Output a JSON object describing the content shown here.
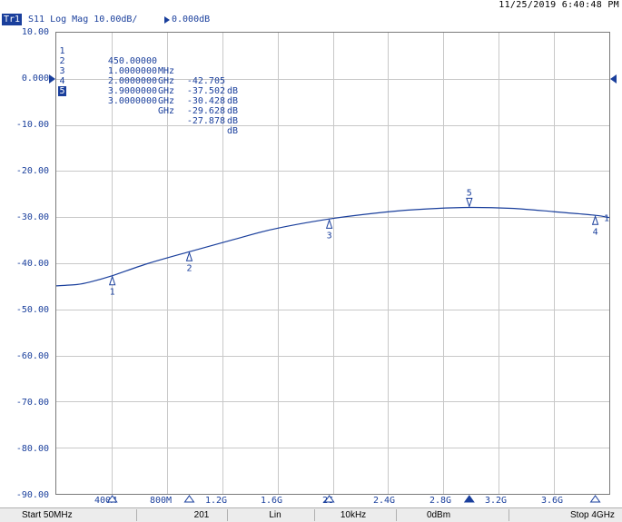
{
  "timestamp": "11/25/2019  6:40:48 PM",
  "trace": {
    "id": "Tr1",
    "parameter": "S11 Log Mag 10.00dB/",
    "reference": "0.000dB"
  },
  "y_axis": {
    "labels": [
      "10.00",
      "0.000",
      "-10.00",
      "-20.00",
      "-30.00",
      "-40.00",
      "-50.00",
      "-60.00",
      "-70.00",
      "-80.00",
      "-90.00"
    ]
  },
  "x_axis": {
    "labels": [
      "400M",
      "800M",
      "1.2G",
      "1.6G",
      "2G",
      "2.4G",
      "2.8G",
      "3.2G",
      "3.6G"
    ]
  },
  "markers": [
    {
      "num": "1",
      "freq": "450.00000",
      "unit": "MHz",
      "value": "-42.705",
      "value_unit": "dB",
      "active": false
    },
    {
      "num": "2",
      "freq": "1.0000000",
      "unit": "GHz",
      "value": "-37.502",
      "value_unit": "dB",
      "active": false
    },
    {
      "num": "3",
      "freq": "2.0000000",
      "unit": "GHz",
      "value": "-30.428",
      "value_unit": "dB",
      "active": false
    },
    {
      "num": "4",
      "freq": "3.9000000",
      "unit": "GHz",
      "value": "-29.628",
      "value_unit": "dB",
      "active": false
    },
    {
      "num": "5",
      "freq": "3.0000000",
      "unit": "GHz",
      "value": "-27.878",
      "value_unit": "dB",
      "active": true
    }
  ],
  "trace_end_label": "1",
  "status_bar": {
    "start": "Start 50MHz",
    "points": "201",
    "sweep": "Lin",
    "ifbw": "10kHz",
    "power": "0dBm",
    "stop": "Stop 4GHz"
  },
  "colors": {
    "trace": "#1a3f9c",
    "grid": "#c8c8c8",
    "background": "#ffffff"
  },
  "chart_data": {
    "type": "line",
    "title": "",
    "xlabel": "",
    "ylabel": "",
    "xlim_hz": [
      50000000,
      4000000000
    ],
    "ylim": [
      -90,
      10
    ],
    "grid": true,
    "series": [
      {
        "x_hz": [
          50000000,
          200000000,
          300000000,
          450000000,
          700000000,
          1000000000,
          1300000000,
          1600000000,
          2000000000,
          2400000000,
          2700000000,
          3000000000,
          3300000000,
          3600000000,
          3900000000,
          4000000000
        ],
        "y": [
          -44.9,
          -44.6,
          -44.0,
          -42.7,
          -40.1,
          -37.5,
          -35.0,
          -32.6,
          -30.4,
          -28.9,
          -28.2,
          -27.9,
          -28.1,
          -28.8,
          -29.6,
          -30.1
        ]
      }
    ],
    "markers": [
      {
        "label": "1",
        "x_hz": 450000000,
        "y": -42.705
      },
      {
        "label": "2",
        "x_hz": 1000000000,
        "y": -37.502
      },
      {
        "label": "3",
        "x_hz": 2000000000,
        "y": -30.428
      },
      {
        "label": "4",
        "x_hz": 3900000000,
        "y": -29.628
      },
      {
        "label": "5",
        "x_hz": 3000000000,
        "y": -27.878
      }
    ]
  }
}
